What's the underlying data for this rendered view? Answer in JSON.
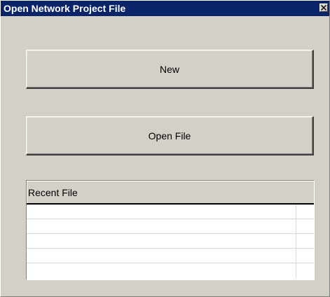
{
  "window": {
    "title": "Open Network Project File",
    "title_bar_color": "#0a246a",
    "face_color": "#d4d0c8",
    "close_icon": "close-icon"
  },
  "actions": {
    "new_label": "New",
    "open_file_label": "Open File"
  },
  "recent_files": {
    "header": "Recent File",
    "rows": [
      "",
      "",
      "",
      "",
      ""
    ]
  }
}
